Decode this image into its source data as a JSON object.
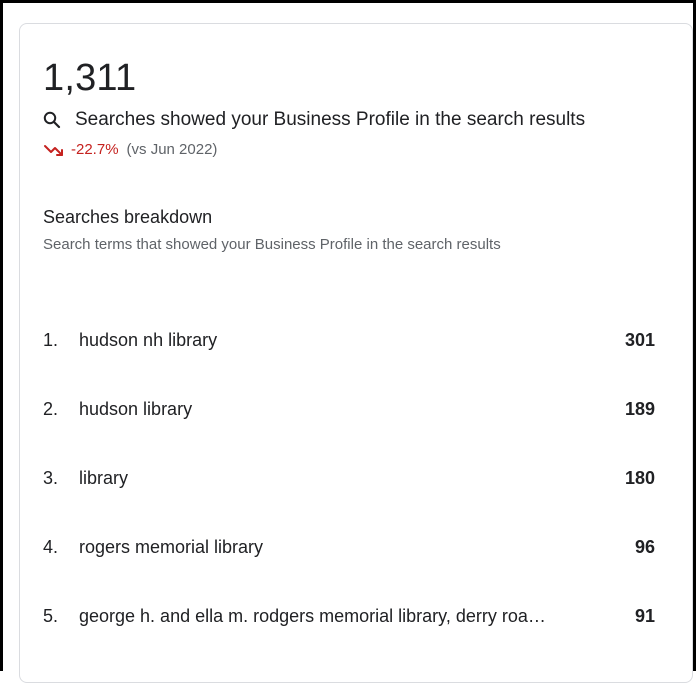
{
  "summary": {
    "total_searches": "1,311",
    "description": "Searches showed your Business Profile in the search results",
    "trend_value": "-22.7%",
    "trend_comparison": "(vs Jun 2022)",
    "trend_color": "#c5221f",
    "search_icon": "search-icon",
    "trend_icon": "trending-down-icon"
  },
  "breakdown": {
    "title": "Searches breakdown",
    "subtitle": "Search terms that showed your Business Profile in the search results",
    "items": [
      {
        "rank": "1.",
        "term": "hudson nh library",
        "count": "301"
      },
      {
        "rank": "2.",
        "term": "hudson library",
        "count": "189"
      },
      {
        "rank": "3.",
        "term": "library",
        "count": "180"
      },
      {
        "rank": "4.",
        "term": "rogers memorial library",
        "count": "96"
      },
      {
        "rank": "5.",
        "term": "george h. and ella m. rodgers memorial library, derry roa…",
        "count": "91"
      }
    ]
  }
}
